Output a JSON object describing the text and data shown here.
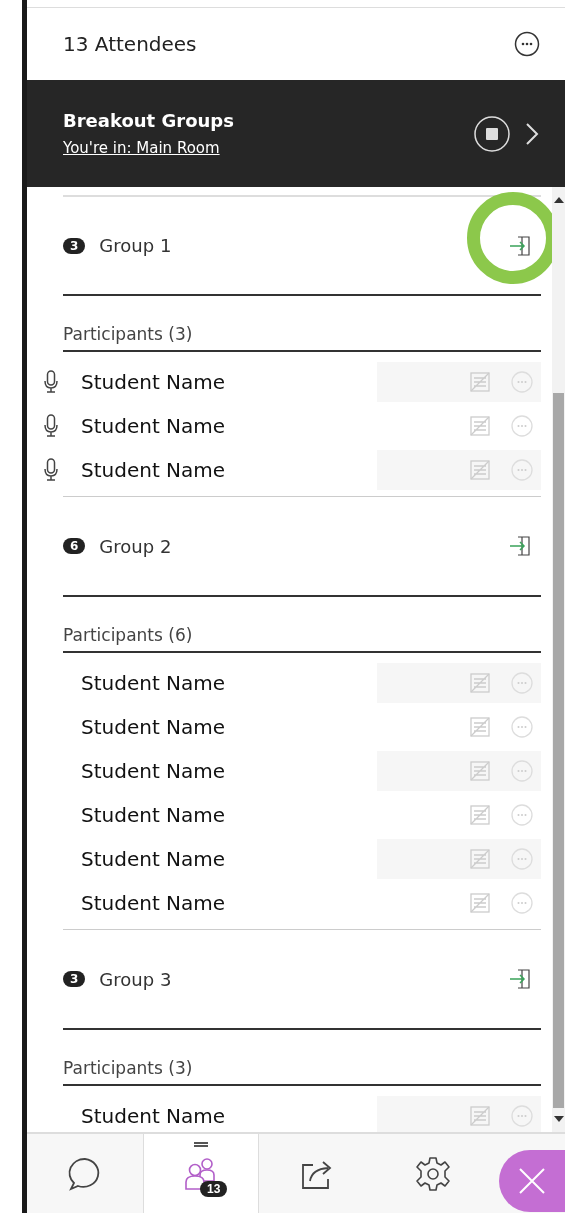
{
  "header": {
    "title": "13 Attendees"
  },
  "breakout": {
    "title": "Breakout Groups",
    "location_link": "You're in: Main Room"
  },
  "groups": [
    {
      "name": "Group 1",
      "count": "3",
      "highlighted": true,
      "participants_label": "Participants (3)",
      "participants": [
        {
          "name": "Student Name",
          "mic": true
        },
        {
          "name": "Student Name",
          "mic": true
        },
        {
          "name": "Student Name",
          "mic": true
        }
      ]
    },
    {
      "name": "Group 2",
      "count": "6",
      "highlighted": false,
      "participants_label": "Participants (6)",
      "participants": [
        {
          "name": "Student Name",
          "mic": false
        },
        {
          "name": "Student Name",
          "mic": false
        },
        {
          "name": "Student Name",
          "mic": false
        },
        {
          "name": "Student Name",
          "mic": false
        },
        {
          "name": "Student Name",
          "mic": false
        },
        {
          "name": "Student Name",
          "mic": false
        }
      ]
    },
    {
      "name": "Group 3",
      "count": "3",
      "highlighted": false,
      "participants_label": "Participants (3)",
      "participants": [
        {
          "name": "Student Name",
          "mic": false
        }
      ]
    }
  ],
  "tabs": [
    {
      "kind": "chat",
      "selected": false
    },
    {
      "kind": "attendees",
      "selected": true,
      "badge": "13"
    },
    {
      "kind": "share",
      "selected": false
    },
    {
      "kind": "settings",
      "selected": false
    }
  ]
}
